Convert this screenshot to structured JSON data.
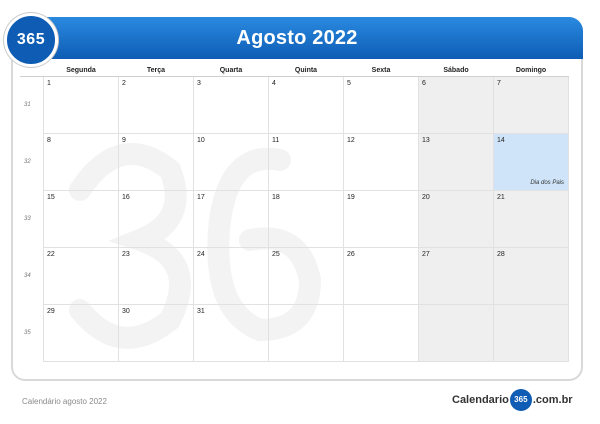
{
  "logo": "365",
  "title": "Agosto 2022",
  "weekdays": [
    "Segunda",
    "Terça",
    "Quarta",
    "Quinta",
    "Sexta",
    "Sábado",
    "Domingo"
  ],
  "weeks": [
    {
      "num": "31",
      "days": [
        "1",
        "2",
        "3",
        "4",
        "5",
        "6",
        "7"
      ]
    },
    {
      "num": "32",
      "days": [
        "8",
        "9",
        "10",
        "11",
        "12",
        "13",
        "14"
      ]
    },
    {
      "num": "33",
      "days": [
        "15",
        "16",
        "17",
        "18",
        "19",
        "20",
        "21"
      ]
    },
    {
      "num": "34",
      "days": [
        "22",
        "23",
        "24",
        "25",
        "26",
        "27",
        "28"
      ]
    },
    {
      "num": "35",
      "days": [
        "29",
        "30",
        "31",
        "",
        "",
        "",
        ""
      ]
    }
  ],
  "event": {
    "day": "14",
    "label": "Dia dos Pais"
  },
  "footer": {
    "caption": "Calendário agosto 2022"
  },
  "brand": {
    "prefix": "Calendario",
    "badge": "365",
    "suffix": ".com.br"
  },
  "colors": {
    "header": "#0e5cb4",
    "weekend": "#efefef",
    "highlight": "#cfe4f8"
  }
}
